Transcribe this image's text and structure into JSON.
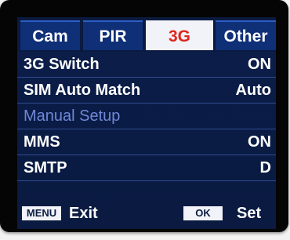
{
  "tabs": [
    {
      "label": "Cam",
      "active": false
    },
    {
      "label": "PIR",
      "active": false
    },
    {
      "label": "3G",
      "active": true
    },
    {
      "label": "Other",
      "active": false
    }
  ],
  "rows": [
    {
      "label": "3G Switch",
      "value": "ON"
    },
    {
      "label": "SIM Auto Match",
      "value": "Auto"
    },
    {
      "label": "Manual Setup",
      "value": ""
    },
    {
      "label": "MMS",
      "value": "ON"
    },
    {
      "label": "SMTP",
      "value": "D"
    }
  ],
  "footer": {
    "menu_key": "MENU",
    "menu_action": "Exit",
    "ok_key": "OK",
    "ok_action": "Set"
  },
  "colors": {
    "screen_bg": "#0b1e4a",
    "tab_bg": "#0f2f77",
    "active_tab_bg": "#f1f3f8",
    "active_tab_text": "#e0261c",
    "disabled_text": "#6f87d8"
  }
}
